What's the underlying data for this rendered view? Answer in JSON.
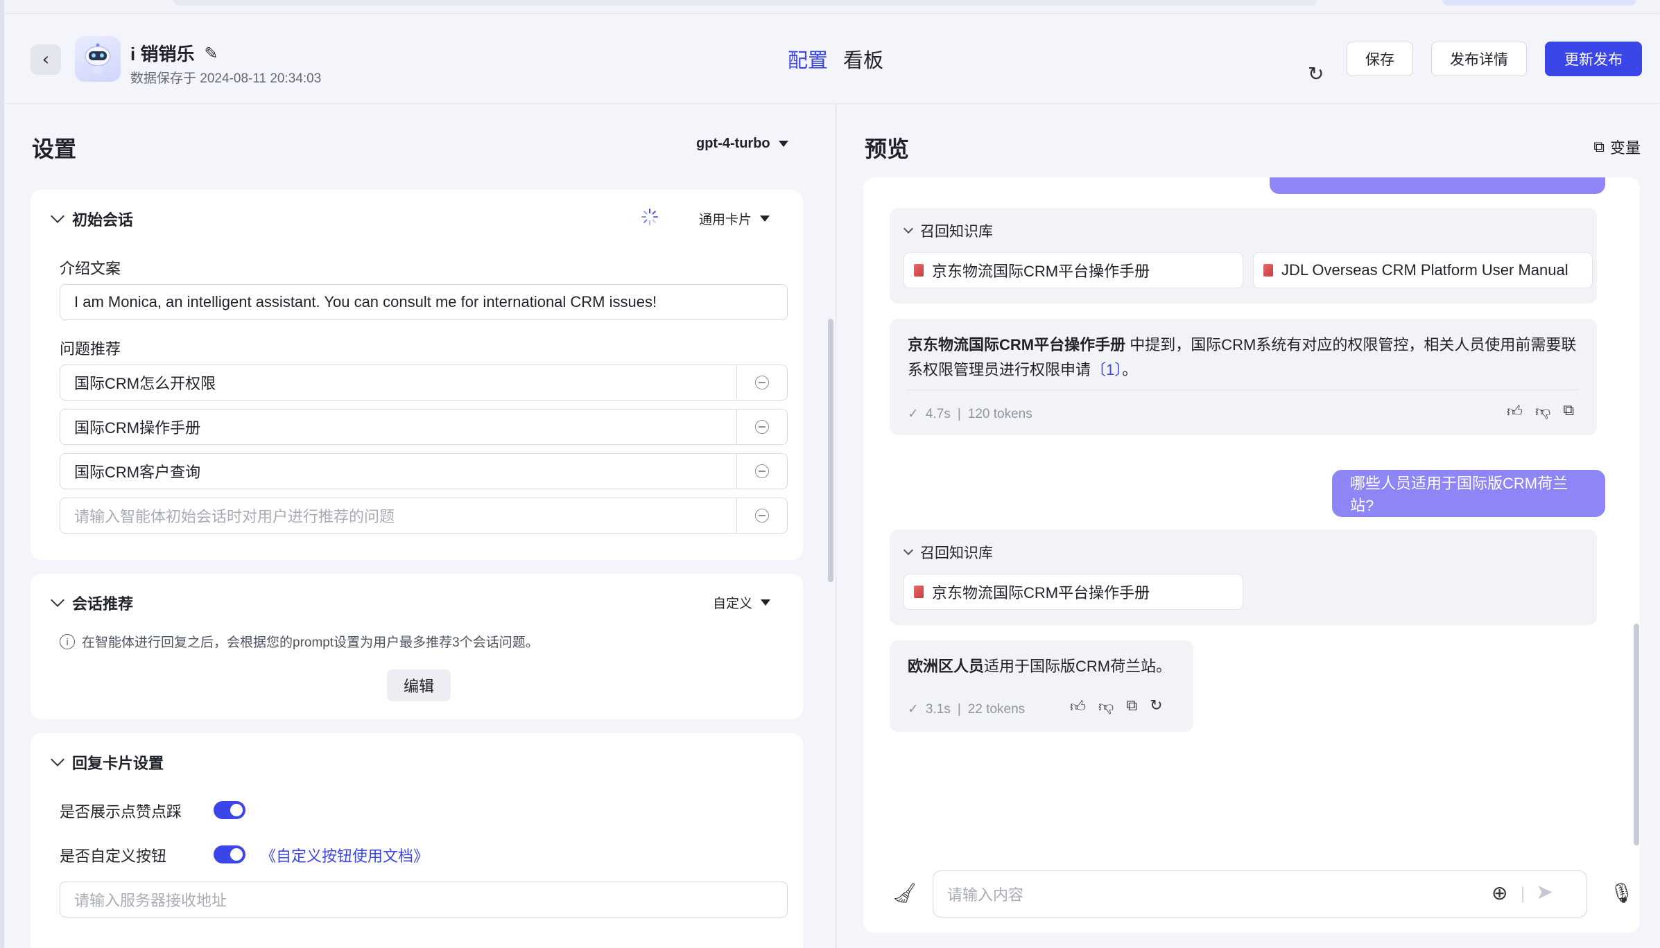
{
  "header": {
    "app_name": "i 销销乐",
    "save_time": "数据保存于 2024-08-11 20:34:03",
    "tabs": [
      {
        "label": "配置",
        "active": true
      },
      {
        "label": "看板",
        "active": false
      }
    ],
    "buttons": {
      "save": "保存",
      "publish_details": "发布详情",
      "update_publish": "更新发布"
    }
  },
  "settings": {
    "title": "设置",
    "model": "gpt-4-turbo",
    "initial_chat": {
      "title": "初始会话",
      "card_type": "通用卡片",
      "intro_label": "介绍文案",
      "intro_value": "I am Monica, an intelligent assistant. You can consult me for international CRM issues!",
      "questions_label": "问题推荐",
      "questions": [
        "国际CRM怎么开权限",
        "国际CRM操作手册",
        "国际CRM客户查询"
      ],
      "question_placeholder": "请输入智能体初始会话时对用户进行推荐的问题"
    },
    "chat_recommend": {
      "title": "会话推荐",
      "mode": "自定义",
      "info": "在智能体进行回复之后，会根据您的prompt设置为用户最多推荐3个会话问题。",
      "edit_label": "编辑"
    },
    "reply_card": {
      "title": "回复卡片设置",
      "show_like_label": "是否展示点赞点踩",
      "show_like": true,
      "custom_button_label": "是否自定义按钮",
      "custom_button": true,
      "doc_link": "《自定义按钮使用文档》",
      "server_placeholder": "请输入服务器接收地址"
    }
  },
  "preview": {
    "title": "预览",
    "variables_label": "变量",
    "messages": [
      {
        "type": "kb",
        "title": "召回知识库",
        "docs": [
          "京东物流国际CRM平台操作手册",
          "JDL Overseas CRM Platform User Manual"
        ]
      },
      {
        "type": "answer",
        "bold": "京东物流国际CRM平台操作手册",
        "text_line1": " 中提到，国际CRM系统有对应的权限管控，相关人员使用前需要联",
        "text_line2": "系权限管理员进行权限申请",
        "cite": "〔1〕",
        "end": "。",
        "time": "4.7s",
        "tokens": "120 tokens"
      },
      {
        "type": "user",
        "text": "哪些人员适用于国际版CRM荷兰站?"
      },
      {
        "type": "kb",
        "title": "召回知识库",
        "docs": [
          "京东物流国际CRM平台操作手册"
        ]
      },
      {
        "type": "answer",
        "bold": "欧洲区人员",
        "text_line1": "适用于国际版CRM荷兰站。",
        "time": "3.1s",
        "tokens": "22 tokens"
      }
    ],
    "input_placeholder": "请输入内容"
  },
  "colors": {
    "accent": "#3b46e8",
    "user_bubble": "#8e86f7"
  }
}
